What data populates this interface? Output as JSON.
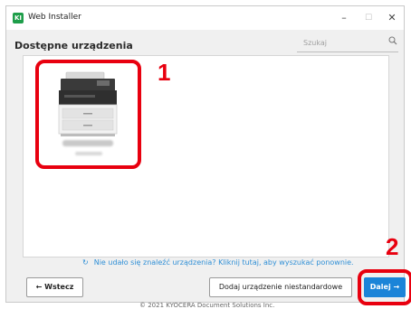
{
  "window": {
    "title": "Web Installer",
    "app_icon_text": "KI",
    "controls": {
      "minimize": "–",
      "maximize": "☐",
      "close": "✕"
    }
  },
  "page": {
    "heading": "Dostępne urządzenia",
    "search": {
      "placeholder": "Szukaj"
    }
  },
  "device": {
    "selected": true
  },
  "annotations": {
    "one": "1",
    "two": "2"
  },
  "refresh": {
    "text": "Nie udało się znaleźć urządzenia? Kliknij tutaj, aby wyszukać ponownie."
  },
  "footer": {
    "back_label": "Wstecz",
    "custom_device_label": "Dodaj urządzenie niestandardowe",
    "next_label": "Dalej",
    "copyright": "© 2021 KYOCERA Document Solutions Inc."
  },
  "colors": {
    "accent": "#1b84d8",
    "highlight": "#e8000f",
    "refresh_link": "#2f8fd6"
  }
}
